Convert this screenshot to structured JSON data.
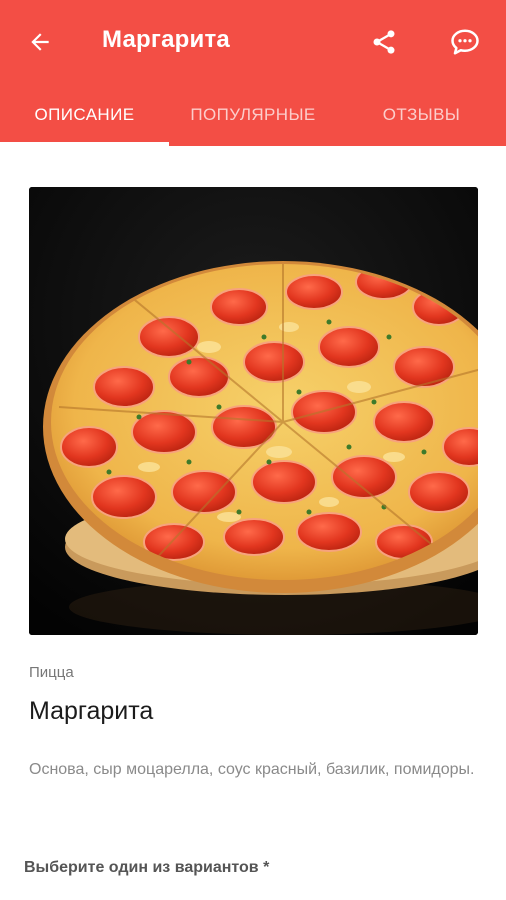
{
  "toolbar": {
    "title": "Маргарита",
    "icons": {
      "back": "arrow-left-icon",
      "share": "share-icon",
      "chat": "chat-bubble-icon"
    }
  },
  "tabs": [
    {
      "label": "ОПИСАНИЕ",
      "active": true
    },
    {
      "label": "ПОПУЛЯРНЫЕ",
      "active": false
    },
    {
      "label": "ОТЗЫВЫ",
      "active": false
    }
  ],
  "product": {
    "image": "pizza-photo",
    "category": "Пицца",
    "name": "Маргарита",
    "description": "Основа, сыр моцарелла, соус красный, базилик, помидоры."
  },
  "options": {
    "label": "Выберите один из вариантов *"
  },
  "colors": {
    "accent": "#f34e45",
    "on_accent": "#ffffff"
  }
}
